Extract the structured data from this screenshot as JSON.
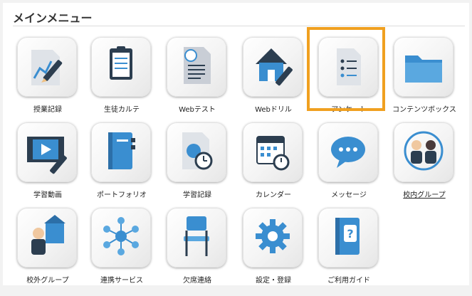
{
  "menu": {
    "title": "メインメニュー",
    "items": [
      {
        "label": "授業記録",
        "icon": "lesson-record-icon"
      },
      {
        "label": "生徒カルテ",
        "icon": "student-chart-icon"
      },
      {
        "label": "Webテスト",
        "icon": "web-test-icon"
      },
      {
        "label": "Webドリル",
        "icon": "web-drill-icon"
      },
      {
        "label": "アンケート",
        "icon": "survey-icon",
        "selected": true
      },
      {
        "label": "コンテンツボックス",
        "icon": "folder-icon"
      },
      {
        "label": "学習動画",
        "icon": "video-icon"
      },
      {
        "label": "ポートフォリオ",
        "icon": "portfolio-icon"
      },
      {
        "label": "学習記録",
        "icon": "learning-record-icon"
      },
      {
        "label": "カレンダー",
        "icon": "calendar-icon"
      },
      {
        "label": "メッセージ",
        "icon": "message-icon"
      },
      {
        "label": "校内グループ",
        "icon": "school-group-icon",
        "underlined": true
      },
      {
        "label": "校外グループ",
        "icon": "external-group-icon"
      },
      {
        "label": "連携サービス",
        "icon": "network-icon"
      },
      {
        "label": "欠席連絡",
        "icon": "chair-icon"
      },
      {
        "label": "設定・登録",
        "icon": "gear-icon"
      },
      {
        "label": "ご利用ガイド",
        "icon": "guide-icon"
      }
    ]
  },
  "colors": {
    "selection": "#f0a020",
    "icon_blue": "#3a8ed0",
    "icon_dark": "#2c3e50"
  }
}
